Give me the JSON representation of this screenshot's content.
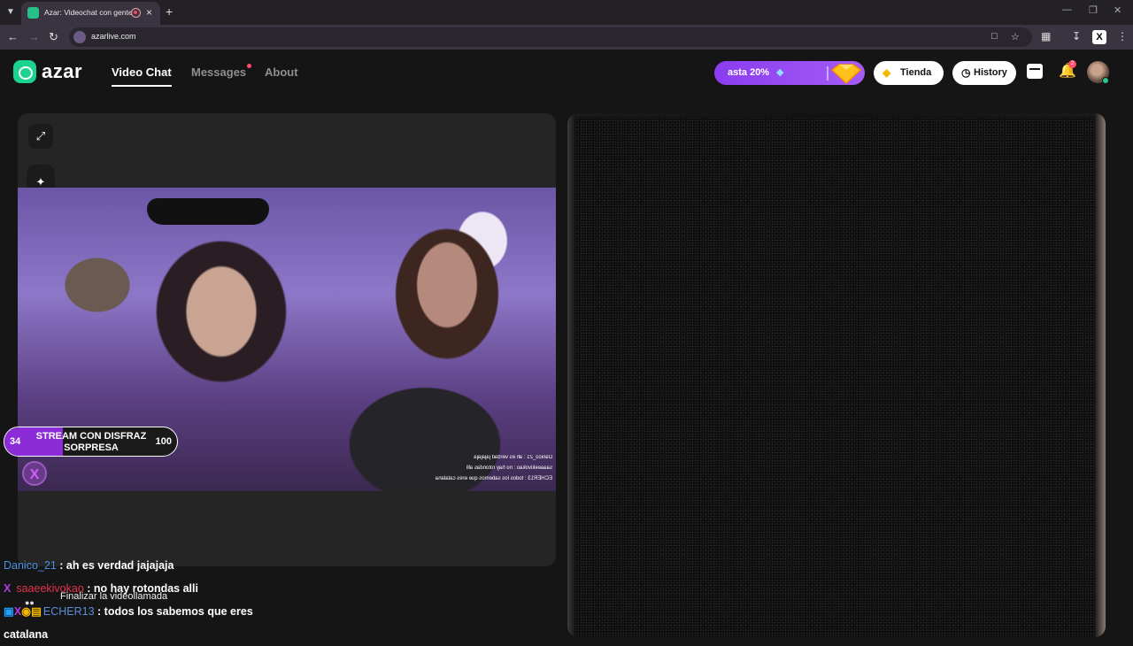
{
  "browser": {
    "tab_title": "Azar: Videochat con gente",
    "url": "azarlive.com"
  },
  "header": {
    "logo": "azar",
    "nav": [
      "Video Chat",
      "Messages",
      "About"
    ],
    "promo": "asta 20%",
    "store_label": "Tienda",
    "history_label": "History",
    "notification_count": "2"
  },
  "video_overlay": {
    "mirrored_chat": [
      "Danico_21 : ah es verdad jajajaja",
      "saaaeekivokao : no hay rotondas alli",
      "ECHER13 : todos los sabemos que eres catalana"
    ],
    "stream_badge": {
      "left": "34",
      "title": "STREAM CON DISFRAZ SORPRESA",
      "right": "100",
      "progress": 0.34
    }
  },
  "chat": [
    {
      "user": "Danico_21",
      "text": " : ah es verdad jajajaja"
    },
    {
      "user": "saaeekivokao",
      "text": " : no hay rotondas alli"
    },
    {
      "user": "ECHER13",
      "text": " : todos los sabemos que eres"
    },
    {
      "user": "",
      "text": "catalana"
    }
  ],
  "end_call_caption": "Finalizar la videollamada",
  "colors": {
    "accent": "#19d38f",
    "promo": "#8a3df0",
    "stream": "#8b2cd8"
  }
}
